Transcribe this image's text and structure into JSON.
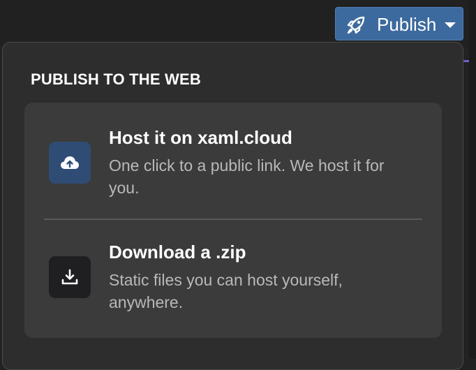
{
  "header": {
    "publish_label": "Publish"
  },
  "dropdown": {
    "section_title": "PUBLISH TO THE WEB",
    "options": [
      {
        "title": "Host it on xaml.cloud",
        "description": "One click to a public link. We host it for you.",
        "icon": "cloud-upload-icon"
      },
      {
        "title": "Download a .zip",
        "description": "Static files you can host yourself, anywhere.",
        "icon": "download-icon"
      }
    ]
  },
  "colors": {
    "publish_button": "#3d6a9e",
    "host_icon_bg": "#2f4d74",
    "download_icon_bg": "#1f1f22",
    "dropdown_bg": "#2d2d2d",
    "card_bg": "#3b3b3b"
  }
}
